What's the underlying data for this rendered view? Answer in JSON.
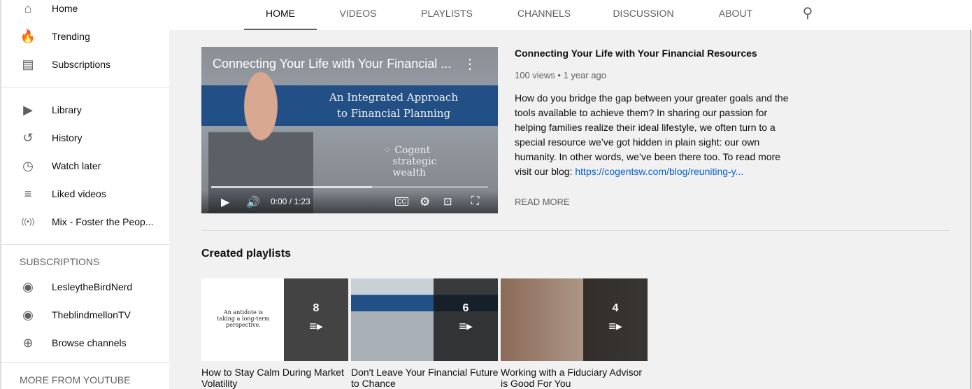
{
  "sidebar": {
    "main": [
      {
        "label": "Home",
        "icon": "home-icon"
      },
      {
        "label": "Trending",
        "icon": "flame-icon"
      },
      {
        "label": "Subscriptions",
        "icon": "subscriptions-icon"
      }
    ],
    "library": [
      {
        "label": "Library",
        "icon": "library-icon"
      },
      {
        "label": "History",
        "icon": "history-icon"
      },
      {
        "label": "Watch later",
        "icon": "clock-icon"
      },
      {
        "label": "Liked videos",
        "icon": "playlist-icon"
      },
      {
        "label": "Mix - Foster the Peop...",
        "icon": "radio-icon"
      }
    ],
    "subscriptions_heading": "SUBSCRIPTIONS",
    "subscriptions": [
      {
        "label": "LesleytheBirdNerd",
        "icon": "channel-avatar"
      },
      {
        "label": "TheblindmellonTV",
        "icon": "channel-avatar"
      },
      {
        "label": "Browse channels",
        "icon": "plus-circle-icon"
      }
    ],
    "more_heading": "MORE FROM YOUTUBE"
  },
  "tabs": [
    "HOME",
    "VIDEOS",
    "PLAYLISTS",
    "CHANNELS",
    "DISCUSSION",
    "ABOUT"
  ],
  "active_tab": "HOME",
  "featured": {
    "player_title": "Connecting Your Life with Your Financial ...",
    "banner_line1": "An Integrated Approach",
    "banner_line2": "to Financial Planning",
    "logo_text": [
      "Cogent",
      "strategic",
      "wealth"
    ],
    "time": "0:00 / 1:23",
    "progress_buffered_percent": 58,
    "title": "Connecting Your Life with Your Financial Resources",
    "meta": "100 views • 1 year ago",
    "description": "How do you bridge the gap between your greater goals and the tools available to achieve them? In sharing our passion for helping families realize their ideal lifestyle, we often turn to a special resource we’ve got hidden in plain sight: our own humanity. In other words, we’ve been there too. To read more visit our blog: ",
    "link": "https://cogentsw.com/blog/reuniting-y...",
    "read_more": "READ MORE"
  },
  "playlists_heading": "Created playlists",
  "playlists": [
    {
      "title": "How to Stay Calm During Market Volatility",
      "count": "8",
      "thumb_text": "An antidote is taking a long-term perspective."
    },
    {
      "title": "Don't Leave Your Financial Future to Chance",
      "count": "6"
    },
    {
      "title": "Working with a Fiduciary Advisor is Good For You",
      "count": "4"
    }
  ],
  "colors": {
    "link": "#065fd4",
    "banner": "#214f86"
  }
}
